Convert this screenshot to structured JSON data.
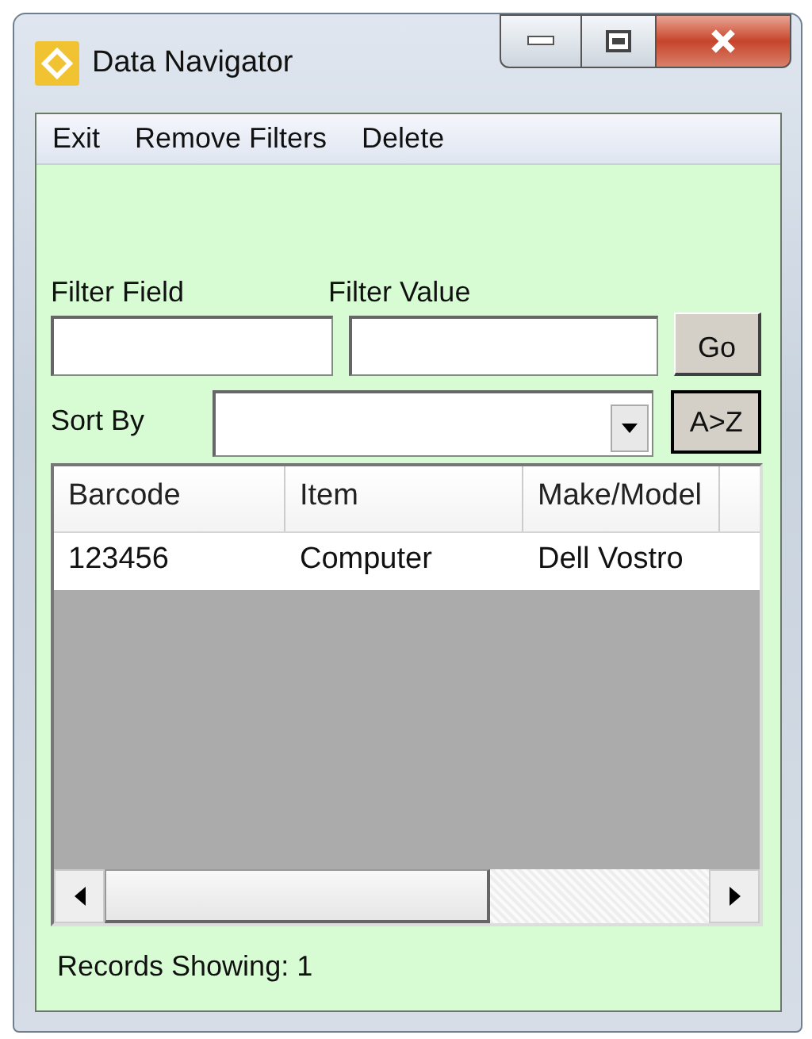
{
  "window": {
    "title": "Data Navigator"
  },
  "menu": [
    "Exit",
    "Remove Filters",
    "Delete"
  ],
  "filter": {
    "field_label": "Filter Field",
    "value_label": "Filter Value",
    "go_button": "Go"
  },
  "sort": {
    "label": "Sort By",
    "order_button": "A>Z"
  },
  "table": {
    "columns": [
      "Barcode",
      "Item",
      "Make/Model"
    ],
    "rows": [
      {
        "cells": [
          "123456",
          "Computer",
          "Dell Vostro"
        ],
        "selected": false
      }
    ]
  },
  "status_bar": "Records Showing: 1"
}
